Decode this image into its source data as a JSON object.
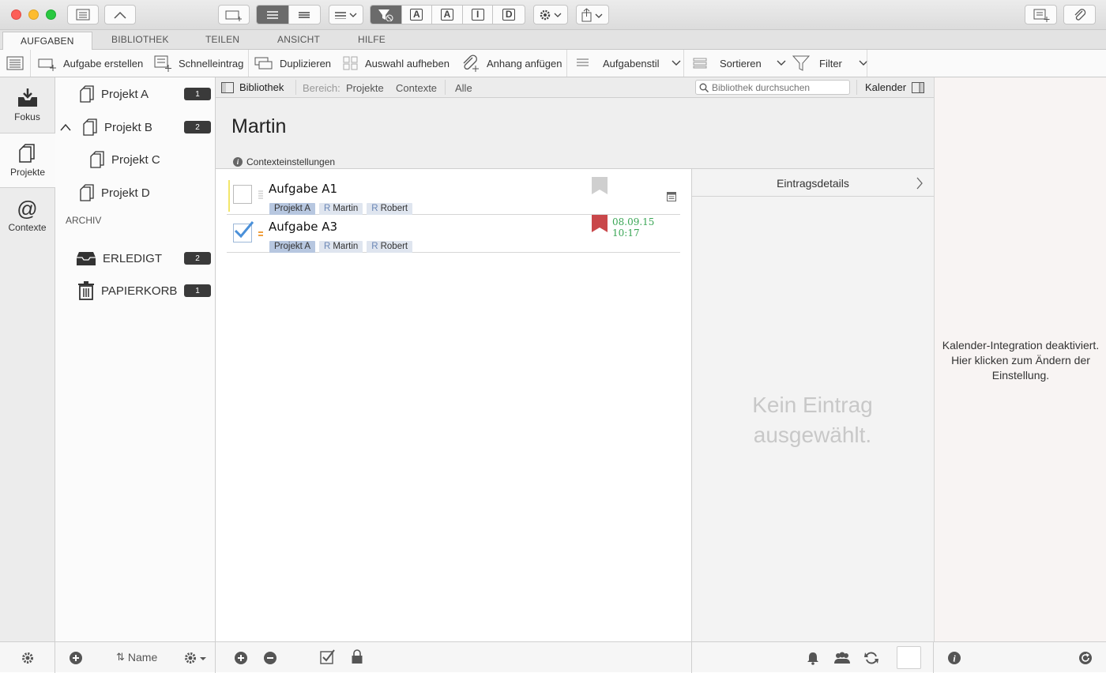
{
  "ribbon_tabs": [
    "AUFGABEN",
    "BIBLIOTHEK",
    "TEILEN",
    "ANSICHT",
    "HILFE"
  ],
  "ribbon": {
    "create_task": "Aufgabe erstellen",
    "quick_entry": "Schnelleintrag",
    "duplicate": "Duplizieren",
    "deselect": "Auswahl aufheben",
    "attach": "Anhang anfügen",
    "task_style": "Aufgabenstil",
    "sort": "Sortieren",
    "filter": "Filter"
  },
  "leftnav": {
    "focus": "Fokus",
    "projects": "Projekte",
    "contexts": "Contexte"
  },
  "projects": [
    {
      "label": "Projekt A",
      "count": "1"
    },
    {
      "label": "Projekt B",
      "count": "2"
    },
    {
      "label": "Projekt C"
    },
    {
      "label": "Projekt D"
    }
  ],
  "archive_header": "ARCHIV",
  "archive": [
    {
      "label": "ERLEDIGT",
      "count": "2"
    },
    {
      "label": "PAPIERKORB",
      "count": "1"
    }
  ],
  "filterbar": {
    "library": "Bibliothek",
    "scope_label": "Bereich:",
    "scope_projects": "Projekte",
    "scope_contexts": "Contexte",
    "scope_all": "Alle",
    "search_placeholder": "Bibliothek durchsuchen",
    "calendar": "Kalender"
  },
  "context": {
    "title": "Martin",
    "settings": "Contexteinstellungen"
  },
  "tasks": [
    {
      "title": "Aufgabe A1",
      "project": "Projekt A",
      "people": [
        "Martin",
        "Robert"
      ],
      "done": false,
      "date": "",
      "flag_color": "#cfcfcf"
    },
    {
      "title": "Aufgabe A3",
      "project": "Projekt A",
      "people": [
        "Martin",
        "Robert"
      ],
      "done": true,
      "date": "08.09.15 10:17",
      "flag_color": "#c9474a"
    }
  ],
  "person_prefix": "R",
  "detail": {
    "header": "Eintragsdetails",
    "empty": "Kein Eintrag ausgewählt."
  },
  "calendar_notice": "Kalender-Integration deaktiviert. Hier klicken zum Ändern der Einstellung.",
  "bottom": {
    "sort_label": "Name"
  },
  "colors": {
    "accent": "#4a90d9",
    "date_green": "#3aa655",
    "badge": "#3a3a3a"
  }
}
